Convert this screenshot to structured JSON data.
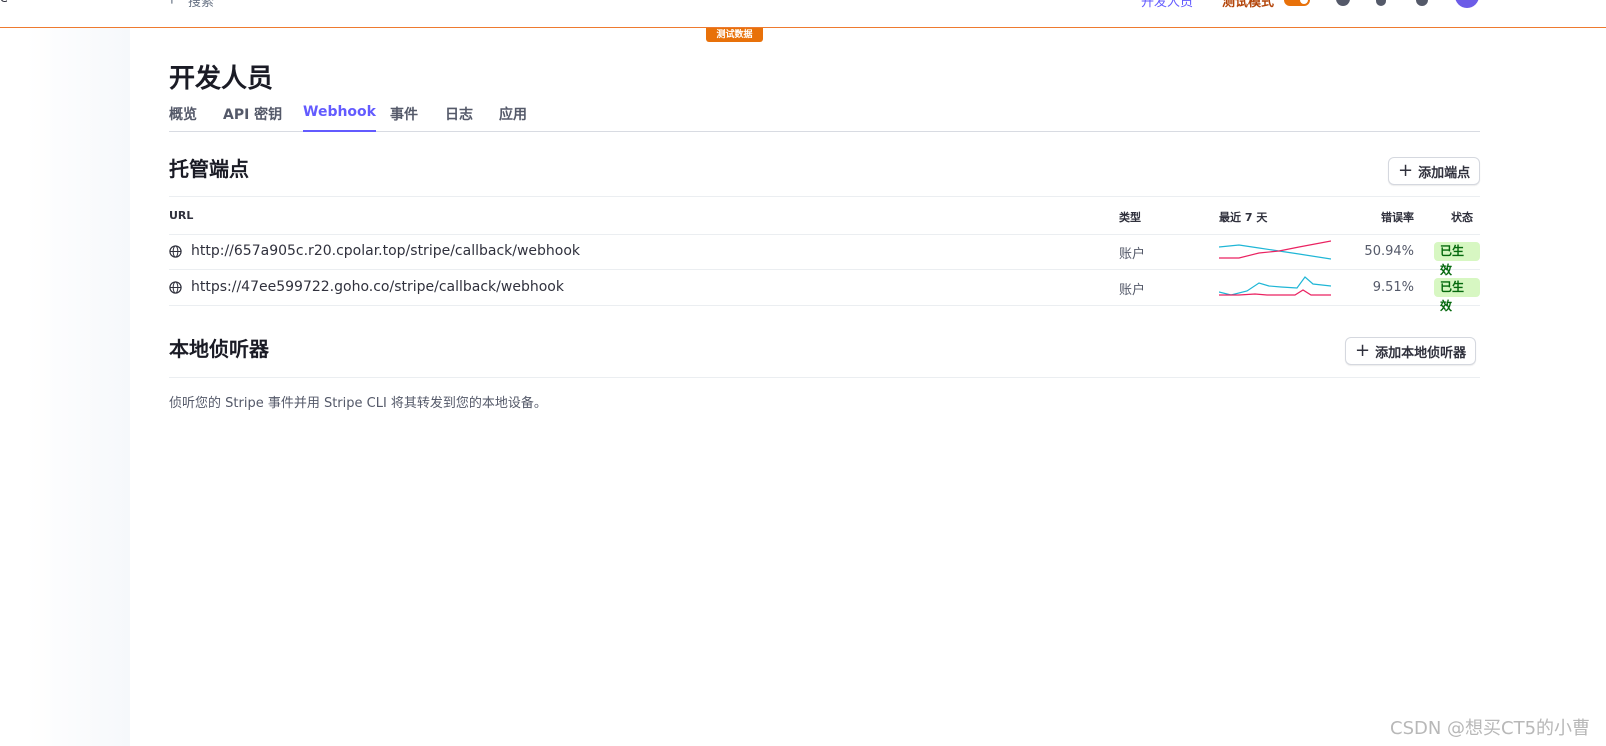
{
  "topbar": {
    "left_glyph": "e",
    "search_placeholder": "搜索",
    "developers_link": "开发人员",
    "test_mode_label": "测试模式",
    "test_data_badge": "测试数据"
  },
  "page": {
    "title": "开发人员"
  },
  "tabs": [
    {
      "label": "概览"
    },
    {
      "label": "API 密钥"
    },
    {
      "label": "Webhook",
      "active": true
    },
    {
      "label": "事件"
    },
    {
      "label": "日志"
    },
    {
      "label": "应用"
    }
  ],
  "hosted": {
    "title": "托管端点",
    "add_button": "添加端点",
    "columns": {
      "url": "URL",
      "type": "类型",
      "last7": "最近 7 天",
      "error_rate": "错误率",
      "status": "状态"
    },
    "rows": [
      {
        "url": "http://657a905c.r20.cpolar.top/stripe/callback/webhook",
        "type": "账户",
        "error_rate": "50.94%",
        "status": "已生效"
      },
      {
        "url": "https://47ee599722.goho.co/stripe/callback/webhook",
        "type": "账户",
        "error_rate": "9.51%",
        "status": "已生效"
      }
    ]
  },
  "local": {
    "title": "本地侦听器",
    "add_button": "添加本地侦听器",
    "description": "侦听您的 Stripe 事件并用 Stripe CLI 将其转发到您的本地设备。"
  },
  "watermark": "CSDN @想买CT5的小曹",
  "colors": {
    "accent": "#635bff",
    "test_orange": "#e8710a",
    "success_bg": "#d7f7c2",
    "spark_blue": "#1fb6d6",
    "spark_red": "#ea2261"
  }
}
